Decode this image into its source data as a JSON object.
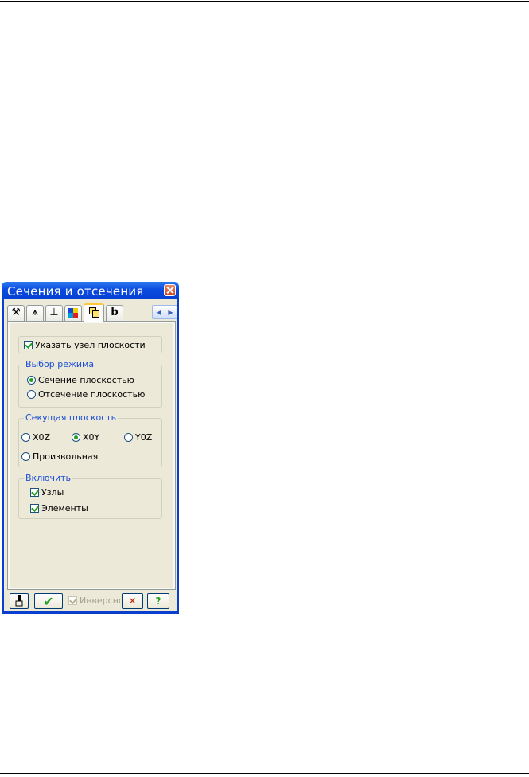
{
  "window": {
    "title": "Сечения и отсечения",
    "tabs": [
      {
        "icon": "hammer-icon",
        "glyph": "⚒"
      },
      {
        "icon": "compass-icon",
        "glyph": "⩚"
      },
      {
        "icon": "support-node-icon",
        "glyph": "⊥"
      },
      {
        "icon": "color-scale-icon",
        "glyph": "▦"
      },
      {
        "icon": "section-planes-icon",
        "glyph": "⧉",
        "active": true
      },
      {
        "icon": "document-b-icon",
        "glyph": "b"
      }
    ],
    "tab_scroll": {
      "left": "◀",
      "right": "▶"
    }
  },
  "content": {
    "specify_node": {
      "label": "Указать узел плоскости",
      "checked": true
    },
    "mode_group": {
      "legend": "Выбор режима",
      "options": [
        "Сечение плоскостью",
        "Отсечение плоскостью"
      ],
      "selected": 0
    },
    "plane_group": {
      "legend": "Секущая плоскость",
      "options": [
        "X0Z",
        "X0Y",
        "Y0Z",
        "Произвольная"
      ],
      "selected": 1
    },
    "include_group": {
      "legend": "Включить",
      "nodes": {
        "label": "Узлы",
        "checked": true
      },
      "elements": {
        "label": "Элементы",
        "checked": true
      }
    }
  },
  "footer": {
    "inverse": {
      "label": "Инверсно",
      "checked": true,
      "enabled": false
    },
    "apply_glyph": "✔",
    "cancel_glyph": "✕",
    "help_glyph": "?"
  },
  "colors": {
    "accent_blue": "#1a4ed8",
    "check_green": "#21a121",
    "cancel_red": "#cc2200",
    "titlebar": "#0b4be0",
    "dialog_bg": "#ece9d8"
  }
}
